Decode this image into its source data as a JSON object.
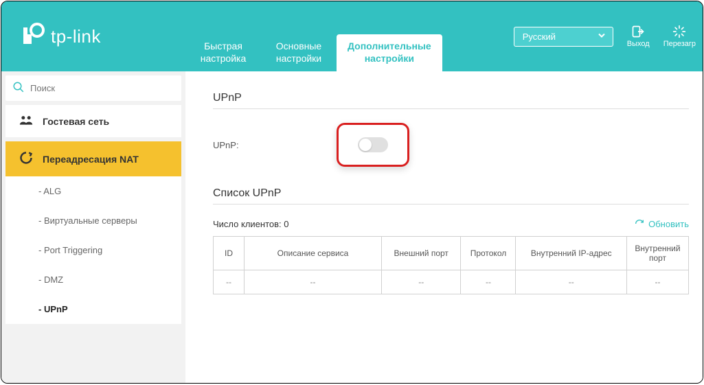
{
  "brand": "tp-link",
  "tabs": {
    "quick": "Быстрая\nнастройка",
    "basic": "Основные\nнастройки",
    "advanced": "Дополнительные\nнастройки"
  },
  "language": "Русский",
  "header_buttons": {
    "logout": "Выход",
    "reboot": "Перезагр"
  },
  "search": {
    "placeholder": "Поиск"
  },
  "sidebar": {
    "guest": "Гостевая сеть",
    "nat": "Переадресация NAT",
    "subs": {
      "alg": "- ALG",
      "virtual": "- Виртуальные серверы",
      "port": "- Port Triggering",
      "dmz": "- DMZ",
      "upnp": "- UPnP"
    }
  },
  "section": {
    "upnp_title": "UPnP",
    "upnp_label": "UPnP:"
  },
  "list": {
    "title": "Список UPnP",
    "clients_label": "Число клиентов: 0",
    "refresh": "Обновить",
    "columns": {
      "id": "ID",
      "desc": "Описание сервиса",
      "ext_port": "Внешний порт",
      "proto": "Протокол",
      "int_ip": "Внутренний IP-адрес",
      "int_port": "Внутренний порт"
    },
    "empty": "--"
  }
}
